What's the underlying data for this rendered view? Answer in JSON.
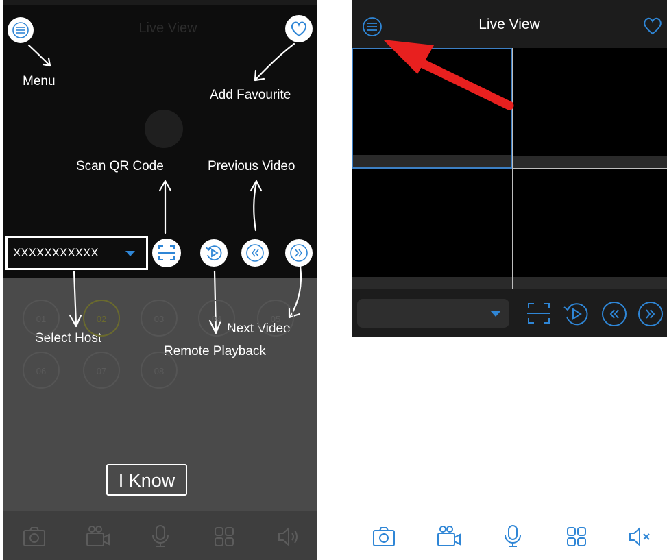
{
  "left_panel": {
    "title": "Live View",
    "annotations": {
      "menu": "Menu",
      "add_favourite": "Add Favourite",
      "scan_qr": "Scan QR Code",
      "previous_video": "Previous Video",
      "select_host": "Select Host",
      "next_video": "Next Video",
      "remote_playback": "Remote Playback"
    },
    "host_select_value": "XXXXXXXXXXX",
    "channels": [
      "01",
      "02",
      "03",
      "04",
      "05",
      "06",
      "07",
      "08"
    ],
    "iknow_label": "I Know",
    "bottom_icons": [
      "camera-icon",
      "video-record-icon",
      "microphone-icon",
      "grid-icon",
      "speaker-icon"
    ]
  },
  "right_panel": {
    "title": "Live View",
    "grid_tiles": 4,
    "host_select_value": "",
    "controls": [
      "scan-qr-icon",
      "remote-playback-icon",
      "previous-video-icon",
      "next-video-icon"
    ],
    "tabbar": [
      "camera-icon",
      "video-record-icon",
      "microphone-icon",
      "grid-icon",
      "mute-icon"
    ]
  },
  "colors": {
    "accent": "#2f86d6",
    "header_bg": "#1c1c1c",
    "overlay_bg": "#4a4a4a",
    "annotation_arrow": "#e8201f"
  }
}
